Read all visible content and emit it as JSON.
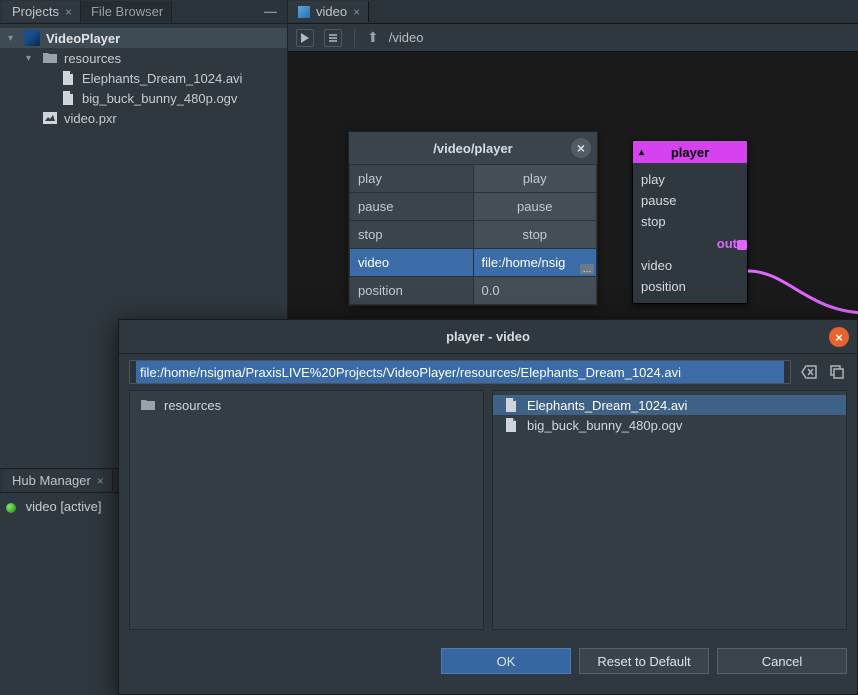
{
  "left_panel": {
    "tabs": [
      "Projects",
      "File Browser"
    ],
    "tree": {
      "project": "VideoPlayer",
      "folder": "resources",
      "files": [
        "Elephants_Dream_1024.avi",
        "big_buck_bunny_480p.ogv"
      ],
      "root_file": "video.pxr"
    }
  },
  "hub": {
    "tab": "Hub Manager",
    "status": "video [active]"
  },
  "canvas": {
    "tab": "video",
    "path": "/video"
  },
  "props": {
    "title": "/video/player",
    "rows": [
      {
        "k": "play",
        "v": "play"
      },
      {
        "k": "pause",
        "v": "pause"
      },
      {
        "k": "stop",
        "v": "stop"
      },
      {
        "k": "video",
        "v": "file:/home/nsig"
      },
      {
        "k": "position",
        "v": "0.0"
      }
    ]
  },
  "node": {
    "title": "player",
    "ports_in": [
      "play",
      "pause",
      "stop"
    ],
    "port_out": "out",
    "params": [
      "video",
      "position"
    ]
  },
  "dialog": {
    "title": "player - video",
    "url": "file:/home/nsigma/PraxisLIVE%20Projects/VideoPlayer/resources/Elephants_Dream_1024.avi",
    "left_items": [
      {
        "icon": "folder",
        "label": "resources"
      }
    ],
    "right_items": [
      {
        "icon": "file",
        "label": "Elephants_Dream_1024.avi",
        "selected": true
      },
      {
        "icon": "file",
        "label": "big_buck_bunny_480p.ogv",
        "selected": false
      }
    ],
    "buttons": {
      "ok": "OK",
      "reset": "Reset to Default",
      "cancel": "Cancel"
    }
  }
}
